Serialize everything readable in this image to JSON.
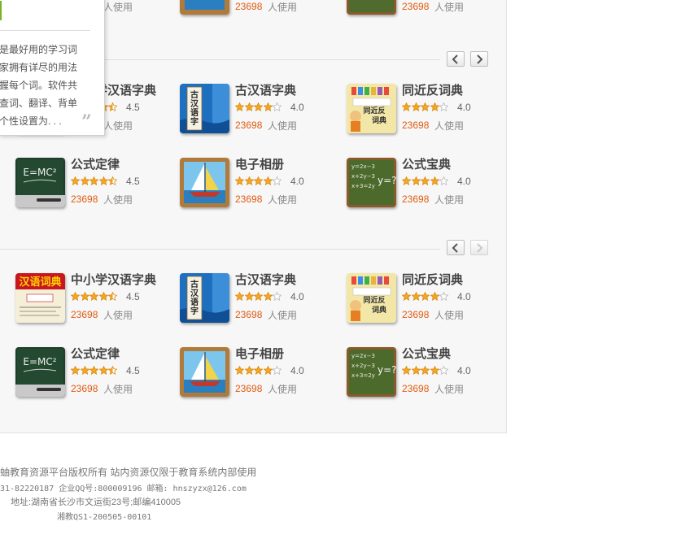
{
  "popup": {
    "description": "是最好用的学习词家拥有详尽的用法握每个词。软件共查词、翻译、背单个性设置为. . ."
  },
  "sections": [
    {
      "top_row": [
        {
          "count": "23698",
          "users_label": "人使用"
        },
        {
          "count": "23698",
          "users_label": "人使用"
        },
        {
          "count": "23698",
          "users_label": "人使用"
        }
      ]
    }
  ],
  "apps_section1": [
    {
      "name": "中小学汉语字典",
      "rating": "4.5",
      "rating_value": 4.5,
      "count": "23698",
      "users_label": "人使用",
      "icon": "dictionary-red-icon"
    },
    {
      "name": "古汉语字典",
      "rating": "4.0",
      "rating_value": 4.0,
      "count": "23698",
      "users_label": "人使用",
      "icon": "ancient-dictionary-icon"
    },
    {
      "name": "同近反词典",
      "rating": "4.0",
      "rating_value": 4.0,
      "count": "23698",
      "users_label": "人使用",
      "icon": "synonym-dictionary-icon"
    },
    {
      "name": "公式定律",
      "rating": "4.5",
      "rating_value": 4.5,
      "count": "23698",
      "users_label": "人使用",
      "icon": "formula-blackboard-icon"
    },
    {
      "name": "电子相册",
      "rating": "4.0",
      "rating_value": 4.0,
      "count": "23698",
      "users_label": "人使用",
      "icon": "sailboat-album-icon"
    },
    {
      "name": "公式宝典",
      "rating": "4.0",
      "rating_value": 4.0,
      "count": "23698",
      "users_label": "人使用",
      "icon": "math-chalkboard-icon"
    }
  ],
  "apps_section2": [
    {
      "name": "中小学汉语字典",
      "rating": "4.5",
      "rating_value": 4.5,
      "count": "23698",
      "users_label": "人使用",
      "icon": "dictionary-red-icon"
    },
    {
      "name": "古汉语字典",
      "rating": "4.0",
      "rating_value": 4.0,
      "count": "23698",
      "users_label": "人使用",
      "icon": "ancient-dictionary-icon"
    },
    {
      "name": "同近反词典",
      "rating": "4.0",
      "rating_value": 4.0,
      "count": "23698",
      "users_label": "人使用",
      "icon": "synonym-dictionary-icon"
    },
    {
      "name": "公式定律",
      "rating": "4.5",
      "rating_value": 4.5,
      "count": "23698",
      "users_label": "人使用",
      "icon": "formula-blackboard-icon"
    },
    {
      "name": "电子相册",
      "rating": "4.0",
      "rating_value": 4.0,
      "count": "23698",
      "users_label": "人使用",
      "icon": "sailboat-album-icon"
    },
    {
      "name": "公式宝典",
      "rating": "4.0",
      "rating_value": 4.0,
      "count": "23698",
      "users_label": "人使用",
      "icon": "math-chalkboard-icon"
    }
  ],
  "icon_text": {
    "dict_title": "汉语词典",
    "ancient": "古汉语字典",
    "synonym": "同近反词典",
    "formula": "E=MC²",
    "math_lines": [
      "y=2x−3",
      "x+2y−3",
      "x+3=2y",
      "y=?"
    ]
  },
  "pagers": [
    {
      "prev_icon": "chevron-left-icon",
      "next_icon": "chevron-right-icon",
      "next_disabled": false
    },
    {
      "prev_icon": "chevron-left-icon",
      "next_icon": "chevron-right-icon",
      "next_disabled": true
    }
  ],
  "footer": {
    "line1": "蚰教育资源平台版权所有 站内资源仅限于教育系统内部使用",
    "line2": "31-82220187 企业QQ号:800009196 邮箱: hnszyzx@126.com",
    "line3": "地址:湖南省长沙市文运街23号;邮编410005",
    "line4": "湘教QS1-200505-00101"
  },
  "colors": {
    "count": "#e05a10",
    "star": "#f5a623",
    "accent": "#79b321"
  }
}
